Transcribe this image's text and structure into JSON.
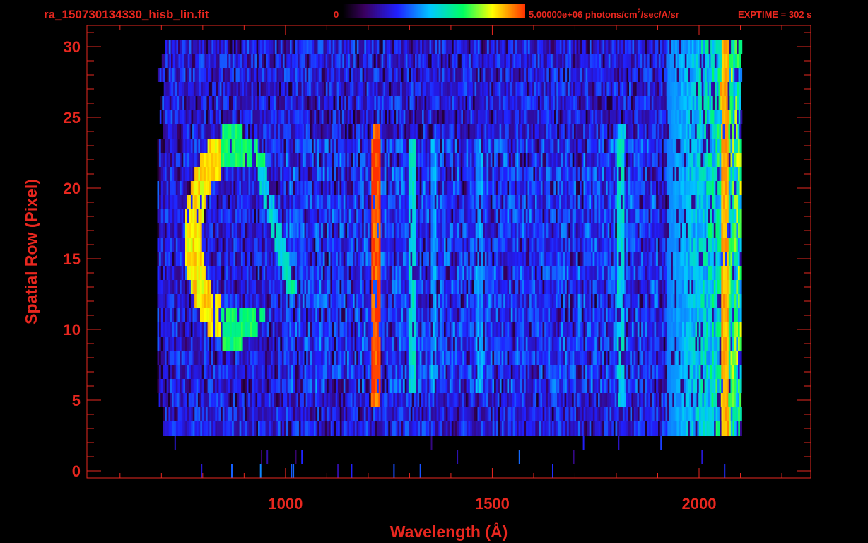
{
  "colors": {
    "background": "#000000",
    "axis": "#e8271f",
    "text": "#e8271f"
  },
  "header": {
    "filename": "ra_150730134330_hisb_lin.fit",
    "colorbar_min": "0",
    "colorbar_max_label": "5.00000e+06 photons/cm",
    "colorbar_max_sup": "2",
    "colorbar_max_unit": "/sec/A/sr",
    "exptime": "EXPTIME = 302 s"
  },
  "chart_data": {
    "type": "heatmap",
    "title": "ra_150730134330_hisb_lin.fit",
    "xlabel": "Wavelength (Å)",
    "ylabel": "Spatial Row (Pixel)",
    "xlim": [
      520,
      2270
    ],
    "ylim": [
      -0.5,
      31.5
    ],
    "x_ticks": [
      1000,
      1500,
      2000
    ],
    "y_ticks": [
      0,
      5,
      10,
      15,
      20,
      25,
      30
    ],
    "grid": false,
    "colorbar": {
      "min": 0,
      "max": 5000000,
      "unit": "photons/cm^2/sec/A/sr",
      "colormap": [
        "#000000",
        "#3a0060",
        "#2020ff",
        "#00c8ff",
        "#00ff60",
        "#ffff00",
        "#ff3000"
      ]
    },
    "exptime_s": 302,
    "data_extent": {
      "wavelength": [
        690,
        2100
      ],
      "rows": [
        3,
        30
      ]
    },
    "features": [
      {
        "name": "Lya",
        "wavelength": 1216,
        "rows": [
          5,
          24
        ],
        "level": 0.9
      },
      {
        "name": "C-arc",
        "wavelength_range": [
          770,
          940
        ],
        "rows": [
          10,
          23
        ],
        "level": 0.75
      },
      {
        "name": "band",
        "wavelength": 1304,
        "rows": [
          6,
          23
        ],
        "level": 0.45
      },
      {
        "name": "band",
        "wavelength": 1356,
        "rows": [
          6,
          23
        ],
        "level": 0.35
      },
      {
        "name": "band",
        "wavelength": 1465,
        "rows": [
          6,
          23
        ],
        "level": 0.35
      },
      {
        "name": "band",
        "wavelength": 1810,
        "rows": [
          5,
          24
        ],
        "level": 0.45
      },
      {
        "name": "band",
        "wavelength": 2060,
        "rows": [
          1,
          30
        ],
        "level": 0.85
      }
    ]
  }
}
